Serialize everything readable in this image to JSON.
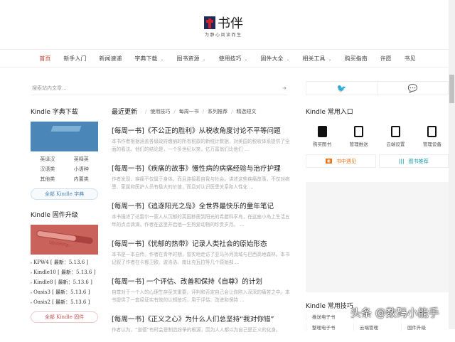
{
  "brand": {
    "name": "书伴",
    "slogan": "为静心阅读而生"
  },
  "nav": [
    {
      "label": "首页",
      "dropdown": false,
      "active": true
    },
    {
      "label": "新手入门",
      "dropdown": false
    },
    {
      "label": "新闻速递",
      "dropdown": false
    },
    {
      "label": "字典下载",
      "dropdown": true
    },
    {
      "label": "图书资源",
      "dropdown": true
    },
    {
      "label": "使用技巧",
      "dropdown": true
    },
    {
      "label": "固件大全",
      "dropdown": true
    },
    {
      "label": "相关工具",
      "dropdown": true
    },
    {
      "label": "购买指南",
      "dropdown": false
    },
    {
      "label": "许愿",
      "dropdown": false
    },
    {
      "label": "书见",
      "dropdown": false
    }
  ],
  "search": {
    "placeholder": "搜索站内文章..."
  },
  "left": {
    "dict_title": "Kindle 字典下载",
    "dict_links": [
      "英译汉",
      "英释英",
      "汉语类",
      "小语种",
      "其他类",
      "内置类"
    ],
    "dict_all": "全部 Kindle 字典",
    "fw_title": "Kindle 固件升级",
    "fw_image_text": "Updating...",
    "fw_list": [
      "KPW4 [ 最新：5.13.6 ]",
      "Kindle10 [ 最新：5.13.6 ]",
      "Kindle8 [ 最新：5.13.6 ]",
      "Oasis3 [ 最新：5.13.6 ]",
      "Oasis2 [ 最新：5.13.6 ]"
    ],
    "fw_all": "全部 Kindle 固件"
  },
  "main": {
    "tab_main": "最近更新",
    "tabs": [
      "使用技巧",
      "每周一书",
      "系列推荐",
      "精选短文"
    ],
    "articles": [
      {
        "title": "[每周一书]《不公正的胜利》从税收角度讨论不平等问题",
        "excerpt": "本书作者根据涵盖各级政府缴纳的所有税款的新统计数据，对美国的税收体系提供了全面的看法。他们的结论是，一个多世纪以来，亿万富翁们比他们 ..."
      },
      {
        "title": "[每周一书]《疾痛的故事》慢性病的病痛经验与治疗护理",
        "excerpt": "作者发现，疾痛不仅属于身体，而且连接着自我与社会。讲述这些疾痛故事，不仅对病患、家属和医护人员有极大的价值，而且对认识医患关系和人性化 ..."
      },
      {
        "title": "[每周一书]《追逐阳光之岛》全世界最快乐的童年笔记",
        "excerpt": "本书描述了达雷尔一家人从沉郁的英国移居到阳光的希腊科孚岛，在这座小岛上生活五年的点点滴滴。作者在这里开启他一生热爱动物的珍贵岁月。 ..."
      },
      {
        "title": "[每周一书]《忧郁的热带》记录人类社会的原始形态",
        "excerpt": "本书是一本自传。作者在青年时期，曾实地走访了亚马孙河流域与巴西高地森林。本书记叙了作者在卡都卫欧、波洛洛、南比克瓦拉等几个原始部 ..."
      },
      {
        "title": "[每周一书] 一个评估、改善和保持《自尊》的计划",
        "excerpt": "自尊对于一个人的心理生存至关重要。评判和否定自己会让你陷入深深的痛苦之中。本书提供了一套经证实有效的认知技巧，用于评估、改进和保持 ..."
      },
      {
        "title": "[每周一书]《正义之心》为什么人们总坚持“我对你错”",
        "excerpt": "作者认为，“道德”有时会是制造纷争的根源，因为人人都以为自己是正义的化身。"
      }
    ]
  },
  "right": {
    "entry_title": "Kindle 常用入口",
    "entries": [
      "购买图书",
      "管理推送",
      "云端设置",
      "管理设备"
    ],
    "btn1": "书中遇见",
    "btn2": "图书推荐",
    "tips_title": "Kindle 常用技巧",
    "tips": [
      "推送电子书",
      "",
      "",
      "整理电子书",
      "云端管理",
      "固件升级"
    ]
  },
  "watermark": "头条 @数码小能手"
}
